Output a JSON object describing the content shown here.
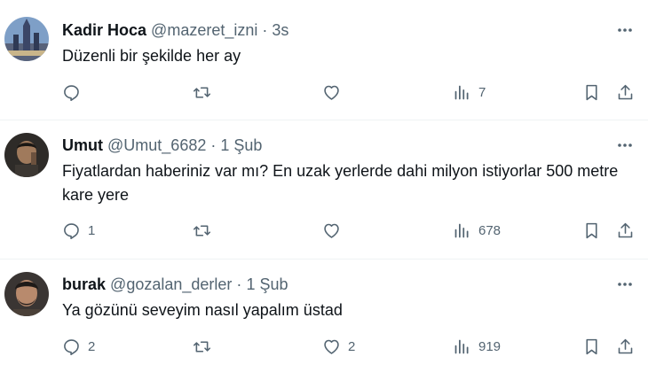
{
  "tweets": [
    {
      "name": "Kadir Hoca",
      "handle": "@mazeret_izni",
      "separator": "·",
      "time": "3s",
      "text": "Düzenli bir şekilde her ay",
      "replies": "",
      "retweets": "",
      "likes": "",
      "views": "7"
    },
    {
      "name": "Umut",
      "handle": "@Umut_6682",
      "separator": "·",
      "time": "1 Şub",
      "text": "Fiyatlardan haberiniz var mı? En uzak yerlerde dahi milyon istiyorlar 500 metre kare yere",
      "replies": "1",
      "retweets": "",
      "likes": "",
      "views": "678"
    },
    {
      "name": "burak",
      "handle": "@gozalan_derler",
      "separator": "·",
      "time": "1 Şub",
      "text": "Ya gözünü seveyim nasıl yapalım üstad",
      "replies": "2",
      "retweets": "",
      "likes": "2",
      "views": "919"
    }
  ],
  "icons": {
    "reply": "reply-icon",
    "retweet": "retweet-icon",
    "like": "heart-icon",
    "views": "views-icon",
    "bookmark": "bookmark-icon",
    "share": "share-icon",
    "more": "more-icon"
  },
  "colors": {
    "text": "#0f1419",
    "secondary": "#536471",
    "divider": "#eff3f4"
  }
}
